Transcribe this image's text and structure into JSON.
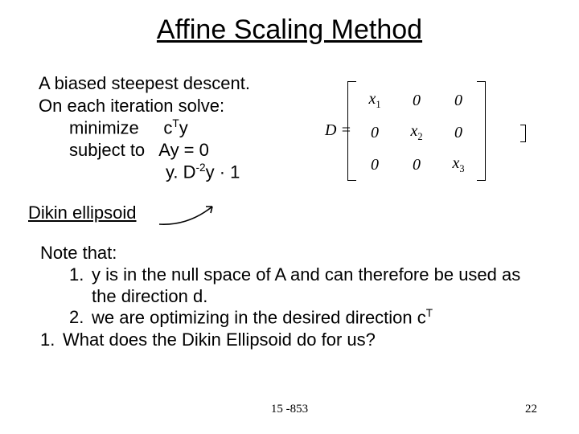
{
  "title": "Affine Scaling Method",
  "body": {
    "line1": "A biased steepest descent.",
    "line2": "On each iteration solve:",
    "minimize_label": "minimize",
    "minimize_expr_head": "c",
    "minimize_expr_sup": "T",
    "minimize_expr_tail": "y",
    "subject_label": "subject to",
    "subject_expr": "Ay = 0",
    "constraint_pre": "y. D",
    "constraint_sup": "-2",
    "constraint_post": "y · 1"
  },
  "dikin_label": "Dikin ellipsoid",
  "matrix": {
    "lhs": "D =",
    "cells": [
      [
        "x|1",
        "0",
        "0"
      ],
      [
        "0",
        "x|2",
        "0"
      ],
      [
        "0",
        "0",
        "x|3"
      ]
    ]
  },
  "notes": {
    "header": "Note that:",
    "item1_num": "1.",
    "item1_text": "y is in the null space of A and can therefore be used as the direction d.",
    "item2_num": "2.",
    "item2_text_pre": "we are optimizing in the desired direction c",
    "item2_text_sup": "T",
    "q_num": "1.",
    "q_text": "What does the Dikin Ellipsoid do for us?"
  },
  "footer": {
    "center": "15 -853",
    "pagenum": "22"
  }
}
